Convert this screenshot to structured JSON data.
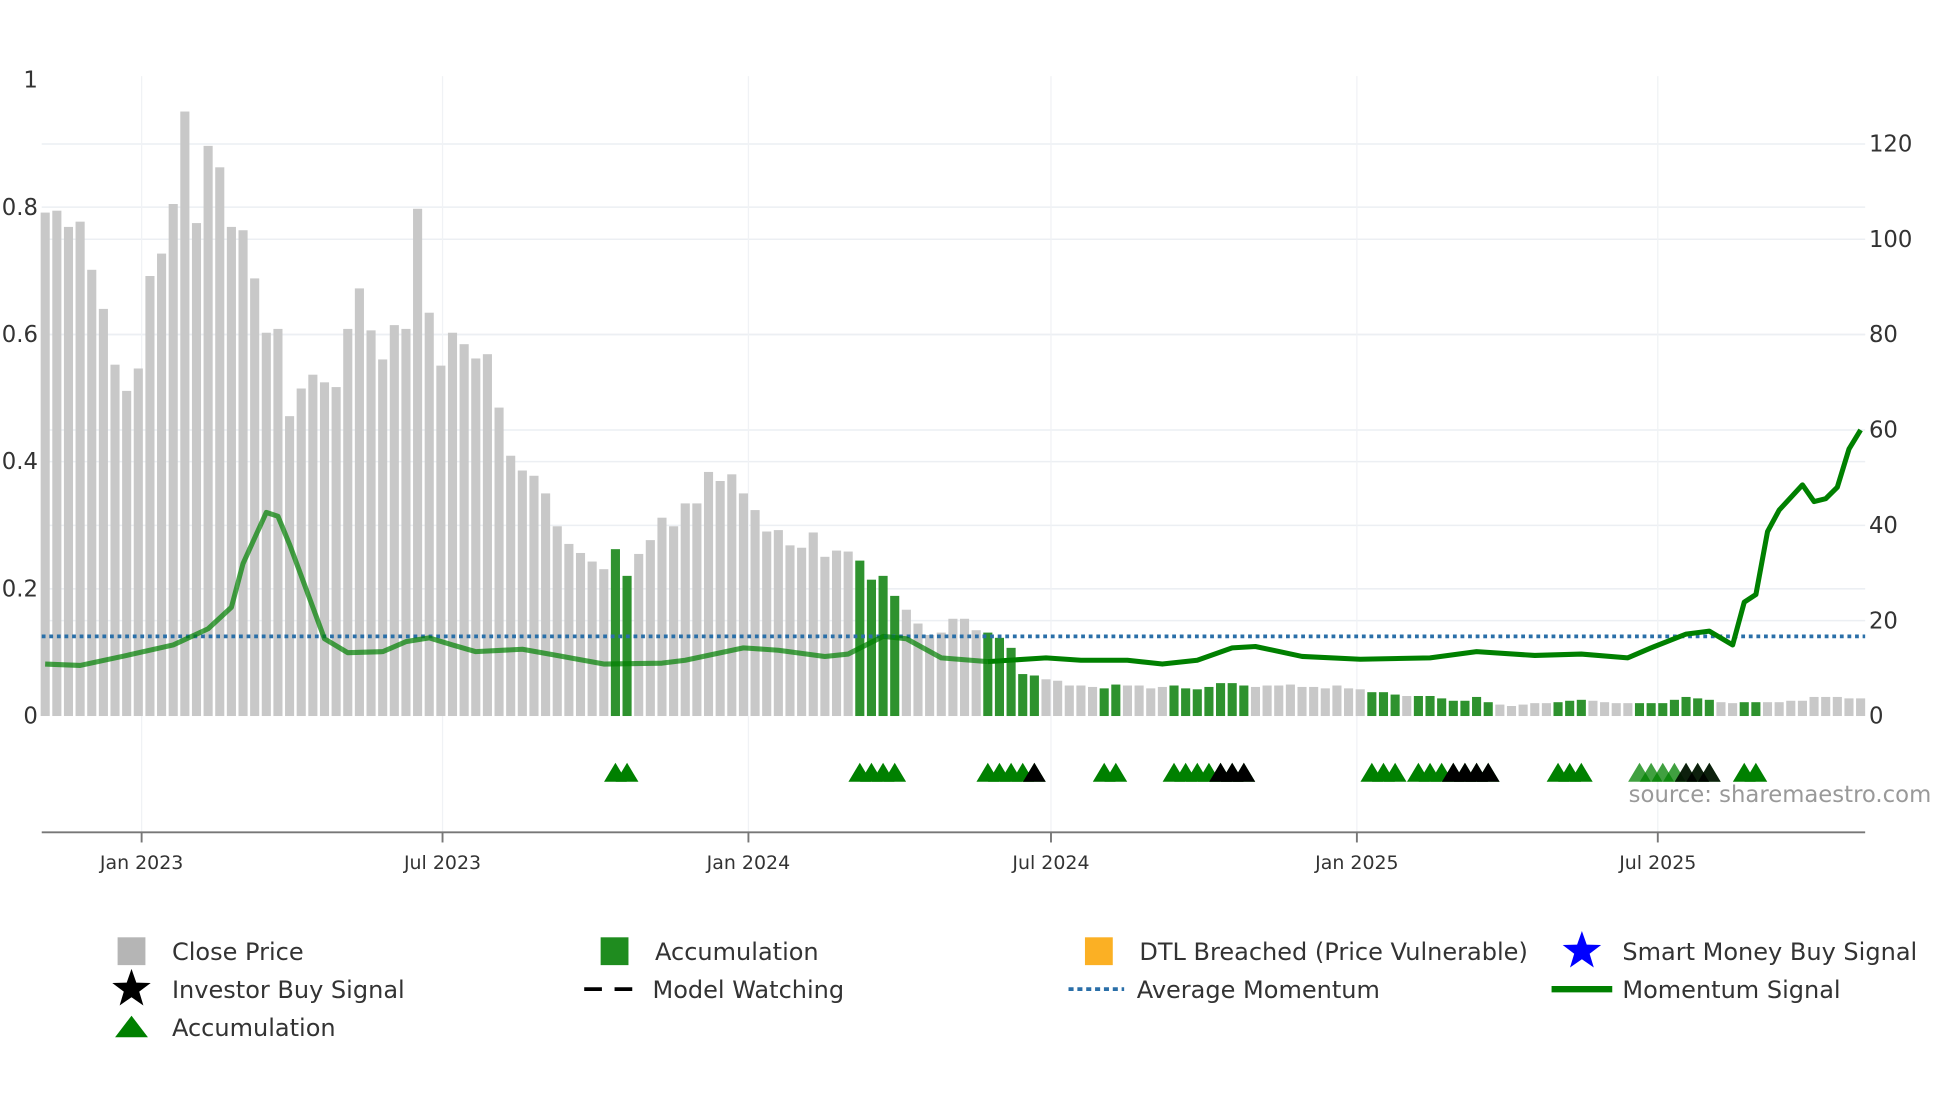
{
  "chart_data": {
    "type": "bar",
    "title": "",
    "left_axis": {
      "range": [
        0,
        1
      ],
      "ticks": [
        "0",
        "0.2",
        "0.4",
        "0.6",
        "0.8",
        "1"
      ]
    },
    "right_axis": {
      "range": [
        0,
        127
      ],
      "ticks": [
        "0",
        "20",
        "40",
        "60",
        "80",
        "100",
        "120"
      ]
    },
    "x_ticks": [
      {
        "date": "2023-01-01",
        "label": "Jan 2023"
      },
      {
        "date": "2023-07-01",
        "label": "Jul 2023"
      },
      {
        "date": "2024-01-01",
        "label": "Jan 2024"
      },
      {
        "date": "2024-07-01",
        "label": "Jul 2024"
      },
      {
        "date": "2025-01-01",
        "label": "Jan 2025"
      },
      {
        "date": "2025-07-01",
        "label": "Jul 2025"
      }
    ],
    "grid": true,
    "dates": [
      "2022-11-04",
      "2022-11-11",
      "2022-11-18",
      "2022-11-25",
      "2022-12-02",
      "2022-12-09",
      "2022-12-16",
      "2022-12-23",
      "2022-12-30",
      "2023-01-06",
      "2023-01-13",
      "2023-01-20",
      "2023-01-27",
      "2023-02-03",
      "2023-02-10",
      "2023-02-17",
      "2023-02-24",
      "2023-03-03",
      "2023-03-10",
      "2023-03-17",
      "2023-03-24",
      "2023-03-31",
      "2023-04-07",
      "2023-04-14",
      "2023-04-21",
      "2023-04-28",
      "2023-05-05",
      "2023-05-12",
      "2023-05-19",
      "2023-05-26",
      "2023-06-02",
      "2023-06-09",
      "2023-06-16",
      "2023-06-23",
      "2023-06-30",
      "2023-07-07",
      "2023-07-14",
      "2023-07-21",
      "2023-07-28",
      "2023-08-04",
      "2023-08-11",
      "2023-08-18",
      "2023-08-25",
      "2023-09-01",
      "2023-09-08",
      "2023-09-15",
      "2023-09-22",
      "2023-09-29",
      "2023-10-06",
      "2023-10-13",
      "2023-10-20",
      "2023-10-27",
      "2023-11-03",
      "2023-11-10",
      "2023-11-17",
      "2023-11-24",
      "2023-12-01",
      "2023-12-08",
      "2023-12-15",
      "2023-12-22",
      "2023-12-29",
      "2024-01-05",
      "2024-01-12",
      "2024-01-19",
      "2024-01-26",
      "2024-02-02",
      "2024-02-09",
      "2024-02-16",
      "2024-02-23",
      "2024-03-01",
      "2024-03-08",
      "2024-03-15",
      "2024-03-22",
      "2024-03-29",
      "2024-04-05",
      "2024-04-12",
      "2024-04-19",
      "2024-04-26",
      "2024-05-03",
      "2024-05-10",
      "2024-05-17",
      "2024-05-24",
      "2024-05-31",
      "2024-06-07",
      "2024-06-14",
      "2024-06-21",
      "2024-06-28",
      "2024-07-05",
      "2024-07-12",
      "2024-07-19",
      "2024-07-26",
      "2024-08-02",
      "2024-08-09",
      "2024-08-16",
      "2024-08-23",
      "2024-08-30",
      "2024-09-06",
      "2024-09-13",
      "2024-09-20",
      "2024-09-27",
      "2024-10-04",
      "2024-10-11",
      "2024-10-18",
      "2024-10-25",
      "2024-11-01",
      "2024-11-08",
      "2024-11-15",
      "2024-11-22",
      "2024-11-29",
      "2024-12-06",
      "2024-12-13",
      "2024-12-20",
      "2024-12-27",
      "2025-01-03",
      "2025-01-10",
      "2025-01-17",
      "2025-01-24",
      "2025-01-31",
      "2025-02-07",
      "2025-02-14",
      "2025-02-21",
      "2025-02-28",
      "2025-03-07",
      "2025-03-14",
      "2025-03-21",
      "2025-03-28",
      "2025-04-04",
      "2025-04-11",
      "2025-04-18",
      "2025-04-25",
      "2025-05-02",
      "2025-05-09",
      "2025-05-16",
      "2025-05-23",
      "2025-05-30",
      "2025-06-06",
      "2025-06-13",
      "2025-06-20",
      "2025-06-27",
      "2025-07-04",
      "2025-07-11",
      "2025-07-18",
      "2025-07-25",
      "2025-08-01",
      "2025-08-08",
      "2025-08-15",
      "2025-08-22",
      "2025-08-29",
      "2025-09-05",
      "2025-09-12",
      "2025-09-19",
      "2025-09-26",
      "2025-10-03",
      "2025-10-10",
      "2025-10-17",
      "2025-10-24",
      "2025-10-31"
    ],
    "series": [
      {
        "name": "Close Price",
        "type": "bar",
        "axis": "right",
        "color": "#c8c8c8",
        "values": [
          105.6,
          106,
          102.6,
          103.7,
          93.6,
          85.4,
          73.7,
          68.2,
          72.9,
          92.3,
          97,
          107.4,
          126.8,
          103.4,
          119.6,
          115.1,
          102.6,
          101.9,
          91.8,
          80.4,
          81.2,
          62.9,
          68.7,
          71.6,
          70,
          69,
          81.2,
          89.7,
          80.9,
          74.8,
          82,
          81.2,
          106.4,
          84.6,
          73.5,
          80.4,
          78,
          75,
          75.9,
          64.7,
          54.6,
          51.5,
          50.4,
          46.7,
          39.8,
          36.1,
          34.2,
          32.4,
          30.8,
          35,
          29.4,
          34,
          36.9,
          41.6,
          39.8,
          44.6,
          44.6,
          51.2,
          49.3,
          50.7,
          46.7,
          43.2,
          38.7,
          39,
          35.8,
          35.3,
          38.5,
          33.4,
          34.7,
          34.5,
          32.6,
          28.6,
          29.4,
          25.2,
          22.3,
          19.4,
          17,
          17.5,
          20.4,
          20.4,
          18,
          17.5,
          16.4,
          14.3,
          8.8,
          8.5,
          7.7,
          7.4,
          6.4,
          6.4,
          6.1,
          5.8,
          6.6,
          6.4,
          6.4,
          5.8,
          6.1,
          6.4,
          5.8,
          5.6,
          6.1,
          6.9,
          6.9,
          6.4,
          6.1,
          6.4,
          6.4,
          6.6,
          6.1,
          6.1,
          5.8,
          6.4,
          5.8,
          5.6,
          5,
          5,
          4.5,
          4.2,
          4.2,
          4.2,
          3.7,
          3.2,
          3.2,
          4,
          2.9,
          2.4,
          2.1,
          2.4,
          2.7,
          2.7,
          2.9,
          3.2,
          3.4,
          3.2,
          2.9,
          2.7,
          2.7,
          2.7,
          2.7,
          2.7,
          3.4,
          4,
          3.7,
          3.4,
          2.9,
          2.7,
          2.9,
          2.9,
          2.9,
          2.9,
          3.2,
          3.2,
          4,
          4,
          4,
          3.7,
          3.7
        ]
      },
      {
        "name": "Accumulation",
        "type": "bar-highlight",
        "color": "#2e922e",
        "dates": [
          "2023-10-13",
          "2023-10-20",
          "2024-03-08",
          "2024-03-15",
          "2024-03-22",
          "2024-03-29",
          "2024-05-24",
          "2024-05-31",
          "2024-06-07",
          "2024-06-14",
          "2024-06-21",
          "2024-08-02",
          "2024-08-09",
          "2024-09-13",
          "2024-09-20",
          "2024-09-27",
          "2024-10-04",
          "2024-10-11",
          "2024-10-18",
          "2024-10-25",
          "2025-01-10",
          "2025-01-17",
          "2025-01-24",
          "2025-02-07",
          "2025-02-14",
          "2025-02-21",
          "2025-02-28",
          "2025-03-07",
          "2025-03-14",
          "2025-03-21",
          "2025-05-02",
          "2025-05-09",
          "2025-05-16",
          "2025-06-20",
          "2025-06-27",
          "2025-07-04",
          "2025-07-11",
          "2025-07-18",
          "2025-07-25",
          "2025-08-01",
          "2025-08-22",
          "2025-08-29"
        ]
      },
      {
        "name": "Investor Buy Signal",
        "type": "marker",
        "color": "#000000",
        "dates": [
          "2024-06-21",
          "2024-10-11",
          "2024-10-18",
          "2024-10-25",
          "2025-02-28",
          "2025-03-07",
          "2025-03-14",
          "2025-03-21",
          "2025-07-18",
          "2025-07-25",
          "2025-08-01"
        ]
      },
      {
        "name": "Momentum Signal",
        "type": "line",
        "axis": "right",
        "color": "#008000",
        "points": [
          [
            "2022-11-04",
            10.9
          ],
          [
            "2022-11-25",
            10.6
          ],
          [
            "2022-12-23",
            12.7
          ],
          [
            "2023-01-20",
            14.9
          ],
          [
            "2023-02-10",
            18.3
          ],
          [
            "2023-02-24",
            22.8
          ],
          [
            "2023-03-03",
            32
          ],
          [
            "2023-03-17",
            42.7
          ],
          [
            "2023-03-24",
            41.9
          ],
          [
            "2023-03-31",
            36
          ],
          [
            "2023-04-14",
            22.8
          ],
          [
            "2023-04-21",
            16.2
          ],
          [
            "2023-05-05",
            13.3
          ],
          [
            "2023-05-26",
            13.5
          ],
          [
            "2023-06-09",
            15.6
          ],
          [
            "2023-06-23",
            16.4
          ],
          [
            "2023-07-07",
            14.9
          ],
          [
            "2023-07-21",
            13.5
          ],
          [
            "2023-08-18",
            14
          ],
          [
            "2023-09-08",
            12.7
          ],
          [
            "2023-10-06",
            10.9
          ],
          [
            "2023-11-10",
            11.1
          ],
          [
            "2023-11-24",
            11.7
          ],
          [
            "2023-12-29",
            14.3
          ],
          [
            "2024-01-19",
            13.8
          ],
          [
            "2024-02-16",
            12.5
          ],
          [
            "2024-03-01",
            13
          ],
          [
            "2024-03-22",
            16.7
          ],
          [
            "2024-04-05",
            16.2
          ],
          [
            "2024-04-26",
            12.2
          ],
          [
            "2024-05-24",
            11.4
          ],
          [
            "2024-06-28",
            12.2
          ],
          [
            "2024-07-19",
            11.7
          ],
          [
            "2024-08-16",
            11.7
          ],
          [
            "2024-09-06",
            10.9
          ],
          [
            "2024-09-27",
            11.7
          ],
          [
            "2024-10-18",
            14.3
          ],
          [
            "2024-11-01",
            14.6
          ],
          [
            "2024-11-29",
            12.5
          ],
          [
            "2025-01-03",
            11.9
          ],
          [
            "2025-02-14",
            12.2
          ],
          [
            "2025-03-14",
            13.5
          ],
          [
            "2025-04-18",
            12.7
          ],
          [
            "2025-05-16",
            13
          ],
          [
            "2025-06-13",
            12.2
          ],
          [
            "2025-06-27",
            14.3
          ],
          [
            "2025-07-18",
            17.2
          ],
          [
            "2025-08-01",
            17.8
          ],
          [
            "2025-08-15",
            14.9
          ],
          [
            "2025-08-22",
            23.9
          ],
          [
            "2025-08-29",
            25.5
          ],
          [
            "2025-09-05",
            38.7
          ],
          [
            "2025-09-12",
            43.2
          ],
          [
            "2025-09-26",
            48.5
          ],
          [
            "2025-10-03",
            45
          ],
          [
            "2025-10-10",
            45.6
          ],
          [
            "2025-10-17",
            48
          ],
          [
            "2025-10-24",
            56
          ],
          [
            "2025-10-31",
            60
          ]
        ]
      },
      {
        "name": "Average Momentum",
        "type": "hline",
        "axis": "right",
        "value": 16.7,
        "color": "#2a6fa8"
      }
    ],
    "legend": {
      "placement": "bottom",
      "items": [
        {
          "label": "Close Price",
          "symbol": "square",
          "color": "#b5b5b5"
        },
        {
          "label": "Accumulation",
          "symbol": "square",
          "color": "#1f8c1f"
        },
        {
          "label": "DTL Breached (Price Vulnerable)",
          "symbol": "square",
          "color": "#fbb024"
        },
        {
          "label": "Smart Money Buy Signal",
          "symbol": "star",
          "color": "#0000ff"
        },
        {
          "label": "Investor Buy Signal",
          "symbol": "star",
          "color": "#000000"
        },
        {
          "label": "Model Watching",
          "symbol": "dashed-line",
          "color": "#000000"
        },
        {
          "label": "Average Momentum",
          "symbol": "dotted-line",
          "color": "#2a6fa8"
        },
        {
          "label": "Momentum Signal",
          "symbol": "line",
          "color": "#008000"
        },
        {
          "label": "Accumulation",
          "symbol": "triangle",
          "color": "#008000"
        }
      ]
    },
    "source": "source: sharemaestro.com"
  }
}
